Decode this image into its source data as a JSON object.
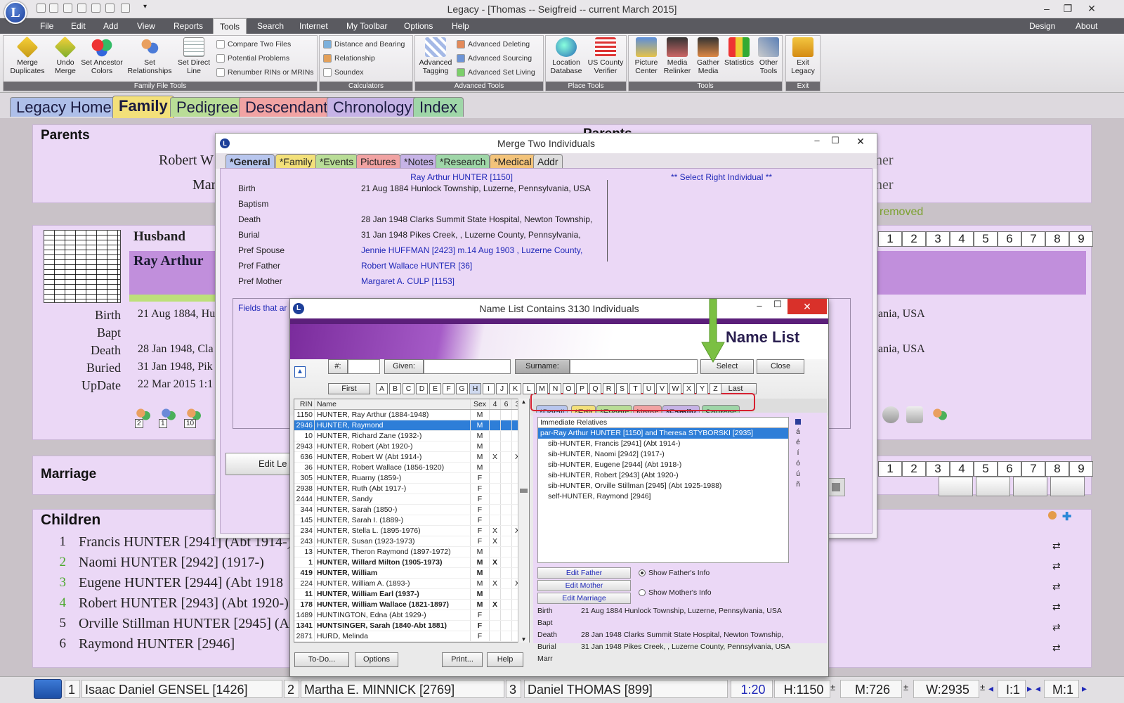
{
  "window": {
    "title": "Legacy - [Thomas -- Seigfreid -- current March 2015]",
    "logo_letter": "L"
  },
  "menu": {
    "items": [
      "File",
      "Edit",
      "Add",
      "View",
      "Reports",
      "Tools",
      "Search",
      "Internet",
      "My Toolbar",
      "Options",
      "Help"
    ],
    "active": "Tools",
    "right": [
      "Design",
      "About"
    ]
  },
  "ribbon": {
    "family_file_tools": {
      "label": "Family File Tools",
      "buttons": [
        "Merge Duplicates",
        "Undo Merge",
        "Set Ancestor Colors",
        "Set Relationships",
        "Set Direct Line"
      ],
      "small": [
        "Compare Two Files",
        "Potential Problems",
        "Renumber RINs or MRINs"
      ]
    },
    "calculators": {
      "label": "Calculators",
      "small": [
        "Distance and Bearing",
        "Relationship",
        "Soundex"
      ]
    },
    "advanced_tools": {
      "label": "Advanced Tools",
      "button": "Advanced Tagging",
      "small": [
        "Advanced Deleting",
        "Advanced Sourcing",
        "Advanced Set Living"
      ]
    },
    "place_tools": {
      "label": "Place Tools",
      "buttons": [
        "Location Database",
        "US County Verifier"
      ]
    },
    "tools": {
      "label": "Tools",
      "buttons": [
        "Picture Center",
        "Media Relinker",
        "Gather Media",
        "Statistics",
        "Other Tools"
      ]
    },
    "exit": {
      "label": "Exit",
      "button": "Exit Legacy"
    }
  },
  "main_tabs": [
    "Legacy Home",
    "Family",
    "Pedigree",
    "Descendant",
    "Chronology",
    "Index"
  ],
  "family_view": {
    "parents_label": "Parents",
    "left_father": "Robert W",
    "left_mother": "Mar",
    "right_parents_partial": "Parents",
    "right_partial_1": "ner",
    "right_partial_2": "ner",
    "removed_text": "removed",
    "husband_label": "Husband",
    "husband_name": "Ray Arthur",
    "events": [
      {
        "label": "Birth",
        "value": "21 Aug 1884, Hu"
      },
      {
        "label": "Bapt",
        "value": ""
      },
      {
        "label": "Death",
        "value": "28 Jan 1948, Cla"
      },
      {
        "label": "Buried",
        "value": "31 Jan 1948, Pik"
      },
      {
        "label": "UpDate",
        "value": "22 Mar 2015 1:1"
      }
    ],
    "right_birth": "ania, USA",
    "right_death": "ania, USA",
    "page_numbers": [
      "1",
      "2",
      "3",
      "4",
      "5",
      "6",
      "7",
      "8",
      "9"
    ],
    "family_icon_counts": [
      "2",
      "1",
      "10"
    ],
    "marriage_label": "Marriage",
    "edit_button": "Edit Le",
    "children_label": "Children",
    "children": [
      {
        "num": "1",
        "name": "Francis HUNTER [2941] (Abt 1914-)"
      },
      {
        "num": "2",
        "name": "Naomi HUNTER [2942] (1917-)"
      },
      {
        "num": "3",
        "name": "Eugene HUNTER [2944] (Abt 1918"
      },
      {
        "num": "4",
        "name": "Robert HUNTER [2943] (Abt 1920-)"
      },
      {
        "num": "5",
        "name": "Orville Stillman HUNTER [2945] (Al"
      },
      {
        "num": "6",
        "name": "Raymond HUNTER [2946]"
      }
    ]
  },
  "merge_dialog": {
    "title": "Merge Two Individuals",
    "tabs": [
      "*General",
      "*Family",
      "*Events",
      "Pictures",
      "*Notes",
      "*Research",
      "*Medical",
      "Addr"
    ],
    "left_name": "Ray Arthur HUNTER [1150]",
    "right_prompt": "** Select Right Individual **",
    "rows": [
      {
        "label": "Birth",
        "value": "21 Aug 1884 Hunlock Township, Luzerne, Pennsylvania, USA"
      },
      {
        "label": "Baptism",
        "value": ""
      },
      {
        "label": "Death",
        "value": "28 Jan 1948 Clarks Summit State Hospital, Newton Township,"
      },
      {
        "label": "Burial",
        "value": "31 Jan 1948 Pikes Creek, , Luzerne County, Pennsylvania,"
      },
      {
        "label": "Pref Spouse",
        "value": "Jennie HUFFMAN [2423] m.14 Aug 1903 , Luzerne County,"
      },
      {
        "label": "Pref Father",
        "value": "Robert Wallace HUNTER [36]"
      },
      {
        "label": "Pref Mother",
        "value": "Margaret A. CULP [1153]"
      }
    ],
    "fields_note": "Fields that ar"
  },
  "name_list": {
    "title": "Name List Contains 3130 Individuals",
    "banner": "Name List",
    "num_label": "#:",
    "given_label": "Given:",
    "surname_label": "Surname:",
    "select_button": "Select",
    "close_button": "Close",
    "first_button": "First",
    "last_button": "Last",
    "letters": [
      "A",
      "B",
      "C",
      "D",
      "E",
      "F",
      "G",
      "H",
      "I",
      "J",
      "K",
      "L",
      "M",
      "N",
      "O",
      "P",
      "Q",
      "R",
      "S",
      "T",
      "U",
      "V",
      "W",
      "X",
      "Y",
      "Z"
    ],
    "selected_letter": "H",
    "columns": [
      "RIN",
      "Name",
      "Sex",
      "4",
      "6",
      "3"
    ],
    "rows": [
      {
        "rin": "1150",
        "name": "HUNTER, Ray Arthur (1884-1948)",
        "sex": "M",
        "a": "",
        "b": "",
        "c": "",
        "bold": false,
        "sel": false
      },
      {
        "rin": "2946",
        "name": "HUNTER, Raymond",
        "sex": "M",
        "a": "",
        "b": "",
        "c": "",
        "bold": false,
        "sel": true
      },
      {
        "rin": "10",
        "name": "HUNTER, Richard Zane (1932-)",
        "sex": "M",
        "a": "",
        "b": "",
        "c": "",
        "bold": false,
        "sel": false
      },
      {
        "rin": "2943",
        "name": "HUNTER, Robert (Abt 1920-)",
        "sex": "M",
        "a": "",
        "b": "",
        "c": "",
        "bold": false,
        "sel": false
      },
      {
        "rin": "636",
        "name": "HUNTER, Robert W (Abt 1914-)",
        "sex": "M",
        "a": "X",
        "b": "",
        "c": "X",
        "bold": false,
        "sel": false
      },
      {
        "rin": "36",
        "name": "HUNTER, Robert Wallace (1856-1920)",
        "sex": "M",
        "a": "",
        "b": "",
        "c": "",
        "bold": false,
        "sel": false
      },
      {
        "rin": "305",
        "name": "HUNTER, Ruarny (1859-)",
        "sex": "F",
        "a": "",
        "b": "",
        "c": "",
        "bold": false,
        "sel": false
      },
      {
        "rin": "2938",
        "name": "HUNTER, Ruth (Abt 1917-)",
        "sex": "F",
        "a": "",
        "b": "",
        "c": "",
        "bold": false,
        "sel": false
      },
      {
        "rin": "2444",
        "name": "HUNTER, Sandy",
        "sex": "F",
        "a": "",
        "b": "",
        "c": "",
        "bold": false,
        "sel": false
      },
      {
        "rin": "344",
        "name": "HUNTER, Sarah (1850-)",
        "sex": "F",
        "a": "",
        "b": "",
        "c": "",
        "bold": false,
        "sel": false
      },
      {
        "rin": "145",
        "name": "HUNTER, Sarah I. (1889-)",
        "sex": "F",
        "a": "",
        "b": "",
        "c": "",
        "bold": false,
        "sel": false
      },
      {
        "rin": "234",
        "name": "HUNTER, Stella L. (1895-1976)",
        "sex": "F",
        "a": "X",
        "b": "",
        "c": "X",
        "bold": false,
        "sel": false
      },
      {
        "rin": "243",
        "name": "HUNTER, Susan (1923-1973)",
        "sex": "F",
        "a": "X",
        "b": "",
        "c": "",
        "bold": false,
        "sel": false
      },
      {
        "rin": "13",
        "name": "HUNTER, Theron Raymond (1897-1972)",
        "sex": "M",
        "a": "",
        "b": "",
        "c": "",
        "bold": false,
        "sel": false
      },
      {
        "rin": "1",
        "name": "HUNTER, Willard Milton (1905-1973)",
        "sex": "M",
        "a": "X",
        "b": "",
        "c": "",
        "bold": true,
        "sel": false
      },
      {
        "rin": "419",
        "name": "HUNTER, William",
        "sex": "M",
        "a": "",
        "b": "",
        "c": "",
        "bold": true,
        "sel": false
      },
      {
        "rin": "224",
        "name": "HUNTER, William A. (1893-)",
        "sex": "M",
        "a": "X",
        "b": "",
        "c": "X",
        "bold": false,
        "sel": false
      },
      {
        "rin": "11",
        "name": "HUNTER, William Earl (1937-)",
        "sex": "M",
        "a": "",
        "b": "",
        "c": "",
        "bold": true,
        "sel": false
      },
      {
        "rin": "178",
        "name": "HUNTER, William Wallace (1821-1897)",
        "sex": "M",
        "a": "X",
        "b": "",
        "c": "",
        "bold": true,
        "sel": false
      },
      {
        "rin": "1489",
        "name": "HUNTINGTON, Edna (Abt 1929-)",
        "sex": "F",
        "a": "",
        "b": "",
        "c": "",
        "bold": false,
        "sel": false
      },
      {
        "rin": "1341",
        "name": "HUNTSINGER, Sarah (1840-Abt 1881)",
        "sex": "F",
        "a": "",
        "b": "",
        "c": "",
        "bold": true,
        "sel": false
      },
      {
        "rin": "2871",
        "name": "HURD, Melinda",
        "sex": "F",
        "a": "",
        "b": "",
        "c": "",
        "bold": false,
        "sel": false
      }
    ],
    "detail_tabs": [
      "*Detail",
      "*Edit",
      "*Events",
      "Notes",
      "*Family",
      "Sources"
    ],
    "active_detail_tab": "*Family",
    "relatives_header": "Immediate Relatives",
    "relatives": [
      {
        "text": "par-Ray Arthur HUNTER [1150] and Theresa STYBORSKI [2935]",
        "sel": true
      },
      {
        "text": "sib-HUNTER, Francis [2941] (Abt 1914-)",
        "sel": false
      },
      {
        "text": "sib-HUNTER, Naomi [2942] (1917-)",
        "sel": false
      },
      {
        "text": "sib-HUNTER, Eugene [2944] (Abt 1918-)",
        "sel": false
      },
      {
        "text": "sib-HUNTER, Robert [2943] (Abt 1920-)",
        "sel": false
      },
      {
        "text": "sib-HUNTER, Orville Stillman [2945] (Abt 1925-1988)",
        "sel": false
      },
      {
        "text": "self-HUNTER, Raymond [2946]",
        "sel": false
      }
    ],
    "side_chars": [
      "á",
      "é",
      "í",
      "ó",
      "ú",
      "ñ"
    ],
    "edit_father": "Edit Father",
    "edit_mother": "Edit Mother",
    "edit_marriage": "Edit Marriage",
    "show_father": "Show Father's Info",
    "show_mother": "Show Mother's Info",
    "info_rows": [
      {
        "label": "Birth",
        "value": "21 Aug 1884 Hunlock Township, Luzerne, Pennsylvania, USA"
      },
      {
        "label": "Bapt",
        "value": ""
      },
      {
        "label": "Death",
        "value": "28 Jan 1948 Clarks Summit State Hospital, Newton Township,"
      },
      {
        "label": "Burial",
        "value": "31 Jan 1948 Pikes Creek, , Luzerne County, Pennsylvania, USA"
      },
      {
        "label": "Marr",
        "value": ""
      }
    ],
    "footer_buttons": [
      "To-Do...",
      "Options",
      "Print...",
      "Help"
    ]
  },
  "status_bar": {
    "s1_num": "1",
    "s1_name": "Isaac Daniel GENSEL [1426]",
    "s2_num": "2",
    "s2_name": "Martha E. MINNICK [2769]",
    "s3_num": "3",
    "s3_name": "Daniel THOMAS [899]",
    "time": "1:20",
    "h": "H:1150",
    "m": "M:726",
    "w": "W:2935",
    "i": "I:1",
    "m2": "M:1",
    "pm": "±"
  },
  "colors": {
    "family_tab": "#f3e07a",
    "home_tab": "#aebfe9",
    "pedigree_tab": "#b9dd97",
    "descendant_tab": "#f1a3a3",
    "chronology_tab": "#c6b3e6",
    "index_tab": "#9fd6a8",
    "panel": "#ebd8f6",
    "husband_bar": "#c18fdc",
    "selection": "#2e7ed8",
    "link_blue": "#1f28b8"
  }
}
